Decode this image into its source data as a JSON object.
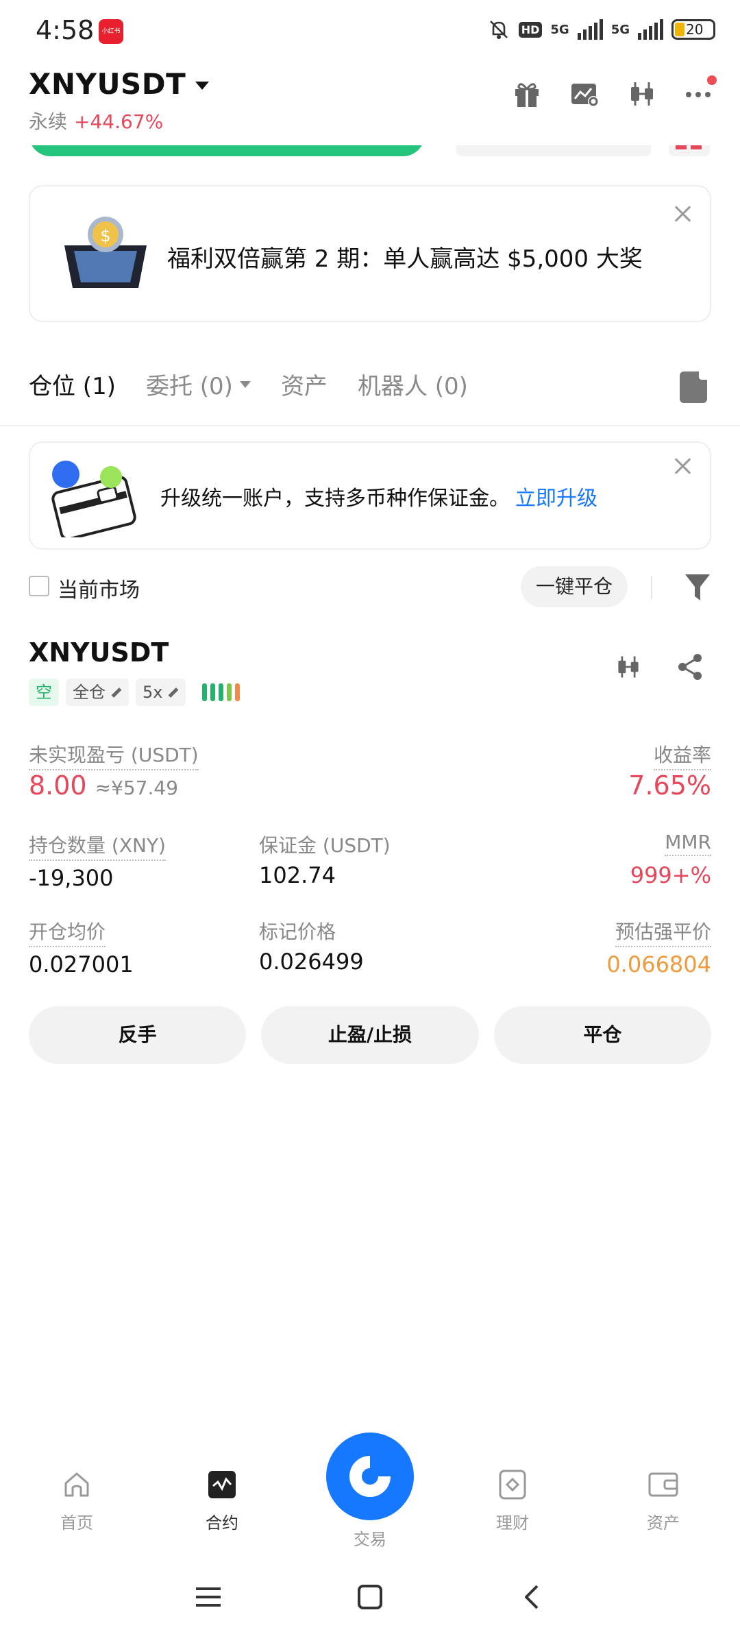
{
  "status_bar": {
    "time": "4:58",
    "app_badge_label": "小红书",
    "hd_label": "HD",
    "network_1": "5G",
    "network_2": "5G",
    "battery": "20"
  },
  "header": {
    "symbol": "XNYUSDT",
    "contract_type": "永续",
    "change_pct": "+44.67%"
  },
  "promo_banner": {
    "text": "福利双倍赢第 2 期：单人赢高达 $5,000 大奖"
  },
  "tabs": [
    {
      "label": "仓位 (1)",
      "active": true
    },
    {
      "label": "委托 (0)",
      "active": false,
      "has_dropdown": true
    },
    {
      "label": "资产",
      "active": false
    },
    {
      "label": "机器人 (0)",
      "active": false
    }
  ],
  "upgrade_banner": {
    "text": "升级统一账户，支持多币种作保证金。",
    "link": "立即升级"
  },
  "filter": {
    "current_market_label": "当前市场",
    "close_all_label": "一键平仓"
  },
  "position": {
    "symbol": "XNYUSDT",
    "side_tag": "空",
    "margin_mode": "全仓",
    "leverage": "5x",
    "risk_bar_colors": [
      "#22b46a",
      "#22b46a",
      "#22b46a",
      "#7cc84a",
      "#f08a4b"
    ],
    "unrealized_pnl_label": "未实现盈亏 (USDT)",
    "unrealized_pnl_value": "8.00",
    "unrealized_pnl_cny": "≈¥57.49",
    "roi_label": "收益率",
    "roi_value": "7.65%",
    "size_label": "持仓数量 (XNY)",
    "size_value": "-19,300",
    "margin_label": "保证金 (USDT)",
    "margin_value": "102.74",
    "mmr_label": "MMR",
    "mmr_value": "999+%",
    "entry_price_label": "开仓均价",
    "entry_price_value": "0.027001",
    "mark_price_label": "标记价格",
    "mark_price_value": "0.026499",
    "liq_price_label": "预估强平价",
    "liq_price_value": "0.066804"
  },
  "actions": {
    "reverse": "反手",
    "tp_sl": "止盈/止损",
    "close": "平仓"
  },
  "bottom_nav": [
    {
      "label": "首页",
      "icon": "home-icon"
    },
    {
      "label": "合约",
      "icon": "futures-icon",
      "active": true
    },
    {
      "label": "交易",
      "icon": "trade-icon"
    },
    {
      "label": "理财",
      "icon": "earn-icon"
    },
    {
      "label": "资产",
      "icon": "wallet-icon"
    }
  ],
  "colors": {
    "accent_blue": "#1677ff",
    "red": "#e5485a",
    "green": "#22b46a",
    "orange": "#f09a3e"
  }
}
